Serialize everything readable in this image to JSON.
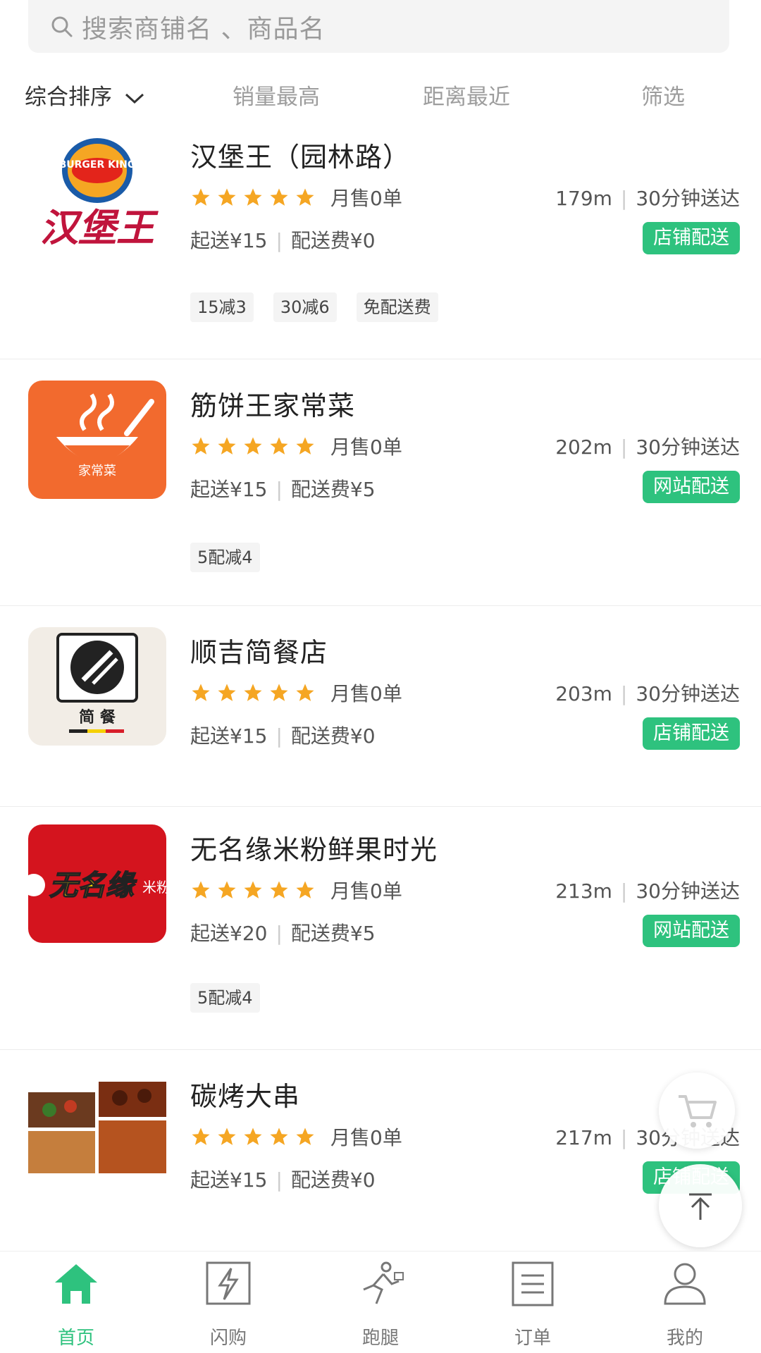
{
  "search": {
    "placeholder": "搜索商铺名 、商品名"
  },
  "sort": {
    "tabs": [
      {
        "label": "综合排序"
      },
      {
        "label": "销量最高"
      },
      {
        "label": "距离最近"
      },
      {
        "label": "筛选"
      }
    ]
  },
  "shops": [
    {
      "name": "汉堡王（园林路）",
      "logo_text": "汉堡王",
      "logo_brand": "BURGER KING",
      "rating": 5,
      "sales": "月售0单",
      "distance": "179m",
      "delivery_time": "30分钟送达",
      "min_order": "起送¥15",
      "delivery_fee": "配送费¥0",
      "delivery_type": "店铺配送",
      "promos": [
        "15减3",
        "30减6",
        "免配送费"
      ]
    },
    {
      "name": "筋饼王家常菜",
      "logo_text": "家常菜",
      "rating": 5,
      "sales": "月售0单",
      "distance": "202m",
      "delivery_time": "30分钟送达",
      "min_order": "起送¥15",
      "delivery_fee": "配送费¥5",
      "delivery_type": "网站配送",
      "promos": [
        "5配减4"
      ]
    },
    {
      "name": "顺吉简餐店",
      "logo_text": "简 餐",
      "rating": 5,
      "sales": "月售0单",
      "distance": "203m",
      "delivery_time": "30分钟送达",
      "min_order": "起送¥15",
      "delivery_fee": "配送费¥0",
      "delivery_type": "店铺配送",
      "promos": []
    },
    {
      "name": "无名缘米粉鲜果时光",
      "logo_text": "无名缘",
      "logo_sub": "米粉",
      "rating": 5,
      "sales": "月售0单",
      "distance": "213m",
      "delivery_time": "30分钟送达",
      "min_order": "起送¥20",
      "delivery_fee": "配送费¥5",
      "delivery_type": "网站配送",
      "promos": [
        "5配减4"
      ]
    },
    {
      "name": "碳烤大串",
      "rating": 5,
      "sales": "月售0单",
      "distance": "217m",
      "delivery_time": "30分钟送达",
      "min_order": "起送¥15",
      "delivery_fee": "配送费¥0",
      "delivery_type": "店铺配送",
      "promos": []
    }
  ],
  "tabbar": {
    "items": [
      {
        "label": "首页",
        "icon": "home-icon"
      },
      {
        "label": "闪购",
        "icon": "flash-icon"
      },
      {
        "label": "跑腿",
        "icon": "runner-icon"
      },
      {
        "label": "订单",
        "icon": "order-icon"
      },
      {
        "label": "我的",
        "icon": "user-icon"
      }
    ]
  },
  "colors": {
    "accent": "#2ec27e",
    "star": "#f5a623"
  }
}
